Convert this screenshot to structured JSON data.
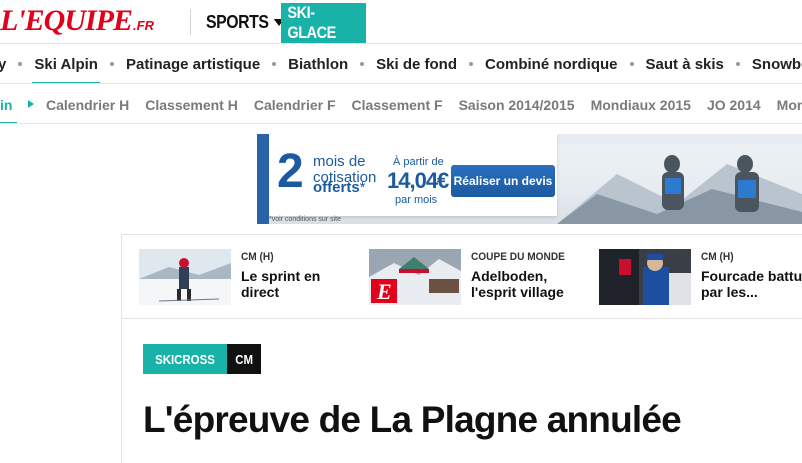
{
  "header": {
    "logo_text": "L'EQUIPE",
    "logo_suffix": ".FR",
    "sports_label": "SPORTS",
    "section_label": "SKI-GLACE"
  },
  "nav_primary": {
    "items": [
      {
        "label": "y"
      },
      {
        "label": "Ski Alpin",
        "active": true
      },
      {
        "label": "Patinage artistique"
      },
      {
        "label": "Biathlon"
      },
      {
        "label": "Ski de fond"
      },
      {
        "label": "Combiné nordique"
      },
      {
        "label": "Saut à skis"
      },
      {
        "label": "Snowboard"
      }
    ]
  },
  "nav_secondary": {
    "current": "in",
    "items": [
      "Calendrier H",
      "Classement H",
      "Calendrier F",
      "Classement F",
      "Saison 2014/2015",
      "Mondiaux 2015",
      "JO 2014",
      "Mon"
    ]
  },
  "ad": {
    "big_number": "2",
    "line1": "mois de",
    "line2": "cotisation",
    "line3": "offerts",
    "asterisk": "*",
    "from_label": "À partir de",
    "price": "14,04€",
    "per_month": "par mois",
    "button_label": "Réaliser un devis",
    "note": "*voir conditions sur site"
  },
  "teasers": [
    {
      "kicker": "CM (H)",
      "title_line1": "Le sprint en",
      "title_line2": "direct"
    },
    {
      "kicker": "COUPE DU MONDE",
      "title_line1": "Adelboden,",
      "title_line2": "l'esprit village"
    },
    {
      "kicker": "CM (H)",
      "title_line1": "Fourcade battu",
      "title_line2": "par les..."
    }
  ],
  "article": {
    "tag_discipline": "SKICROSS",
    "tag_competition": "CM",
    "headline": "L'épreuve de La Plagne annulée"
  },
  "colors": {
    "brand_red": "#e2001a",
    "accent_teal": "#19b2a8",
    "ad_blue": "#1c5aa0"
  }
}
